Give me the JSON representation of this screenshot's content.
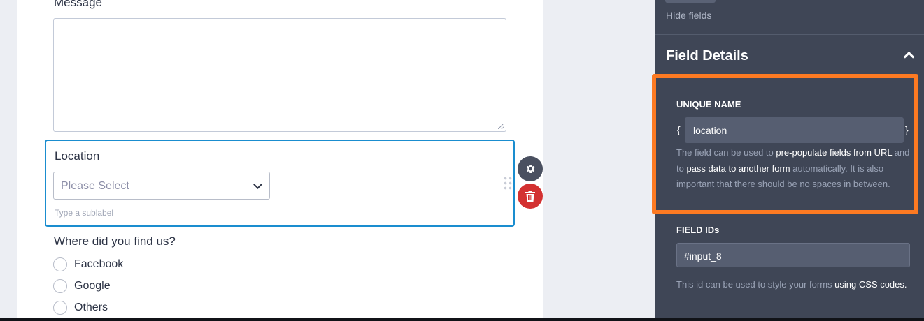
{
  "form": {
    "message": {
      "label": "Message"
    },
    "location": {
      "label": "Location",
      "placeholder": "Please Select",
      "sublabel": "Type a sublabel"
    },
    "found_us": {
      "label": "Where did you find us?",
      "options": [
        "Facebook",
        "Google",
        "Others"
      ]
    },
    "field_actions": {
      "settings_icon": "gear-icon",
      "delete_icon": "trash-icon"
    }
  },
  "panel": {
    "hide_fields": "Hide fields",
    "field_details_title": "Field Details",
    "unique_name": {
      "heading": "UNIQUE NAME",
      "open_brace": "{",
      "close_brace": "}",
      "value": "location",
      "desc_1": "The field can be used to ",
      "desc_link_1": "pre-populate fields from URL",
      "desc_2": " and to ",
      "desc_link_2": "pass data to another form",
      "desc_3": " automatically. It is also important that there should be no spaces in between."
    },
    "field_ids": {
      "heading": "FIELD IDs",
      "value": "#input_8",
      "desc_1": "This id can be used to style your forms ",
      "desc_link": "using CSS codes."
    }
  },
  "colors": {
    "highlight": "#fd7a22",
    "active_border": "#1a8dcf",
    "delete": "#d33131",
    "panel_bg": "#3f4656"
  }
}
